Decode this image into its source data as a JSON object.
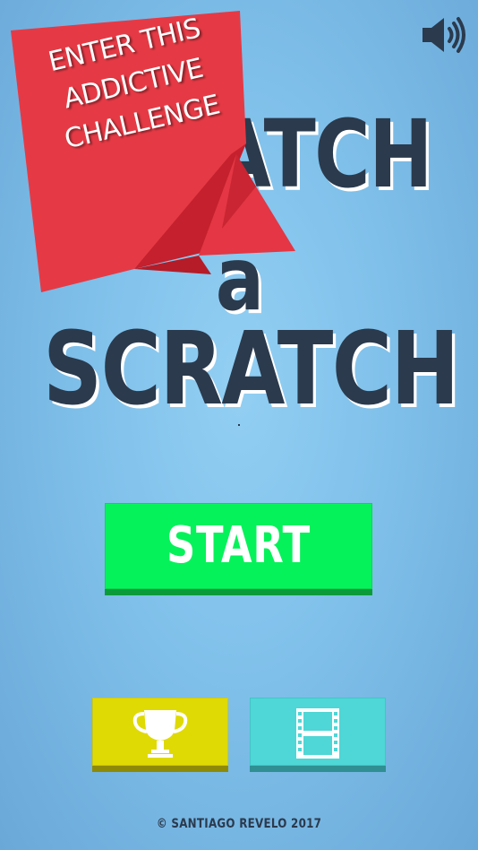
{
  "title": {
    "line1": "SCRATCH",
    "line2": "a",
    "line3": "SCRATCH"
  },
  "banner": {
    "lines": [
      "ENTER THIS",
      "ADDICTIVE",
      "CHALLENGE"
    ]
  },
  "buttons": {
    "start_label": "START",
    "sound_icon": "speaker-volume-icon",
    "trophy_icon": "trophy-icon",
    "video_icon": "film-strip-icon"
  },
  "footer": {
    "copyright": "© SANTIAGO REVELO 2017"
  },
  "colors": {
    "background": "#7fc0ea",
    "title_text": "#2b3a4d",
    "banner_red": "#e53a45",
    "start_green": "#06f25a",
    "trophy_yellow": "#e0da04",
    "video_cyan": "#4fd6d6"
  }
}
